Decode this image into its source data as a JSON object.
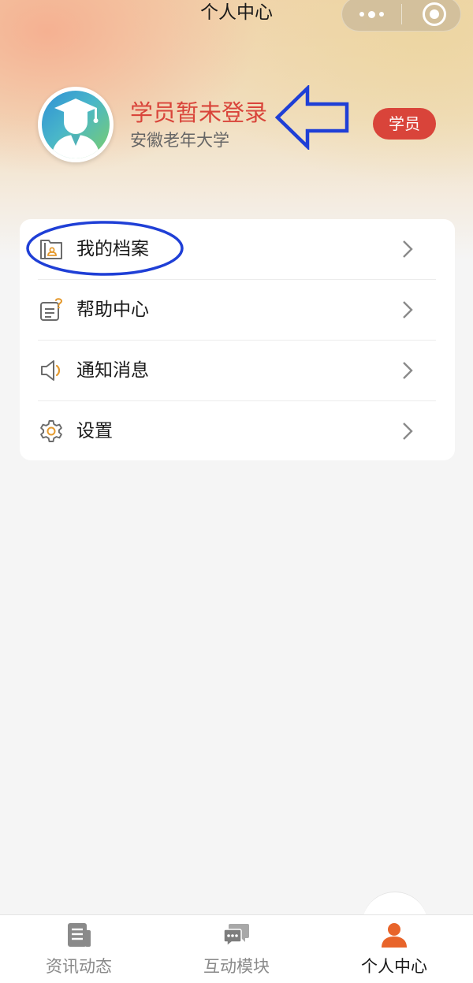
{
  "nav": {
    "title": "个人中心"
  },
  "profile": {
    "name": "学员暂未登录",
    "school": "安徽老年大学",
    "badge": "学员"
  },
  "menu": [
    {
      "label": "我的档案",
      "icon": "archive-folder-icon"
    },
    {
      "label": "帮助中心",
      "icon": "help-document-icon"
    },
    {
      "label": "通知消息",
      "icon": "speaker-icon"
    },
    {
      "label": "设置",
      "icon": "gear-icon"
    }
  ],
  "tabs": [
    {
      "label": "资讯动态",
      "icon": "news-icon",
      "active": false
    },
    {
      "label": "互动模块",
      "icon": "chat-icon",
      "active": false
    },
    {
      "label": "个人中心",
      "icon": "person-icon",
      "active": true
    }
  ],
  "colors": {
    "accent": "#d9443a",
    "active_tab_icon": "#e8642a",
    "annotation": "#1f3fd6",
    "menu_icon_orange": "#e59a2e"
  }
}
